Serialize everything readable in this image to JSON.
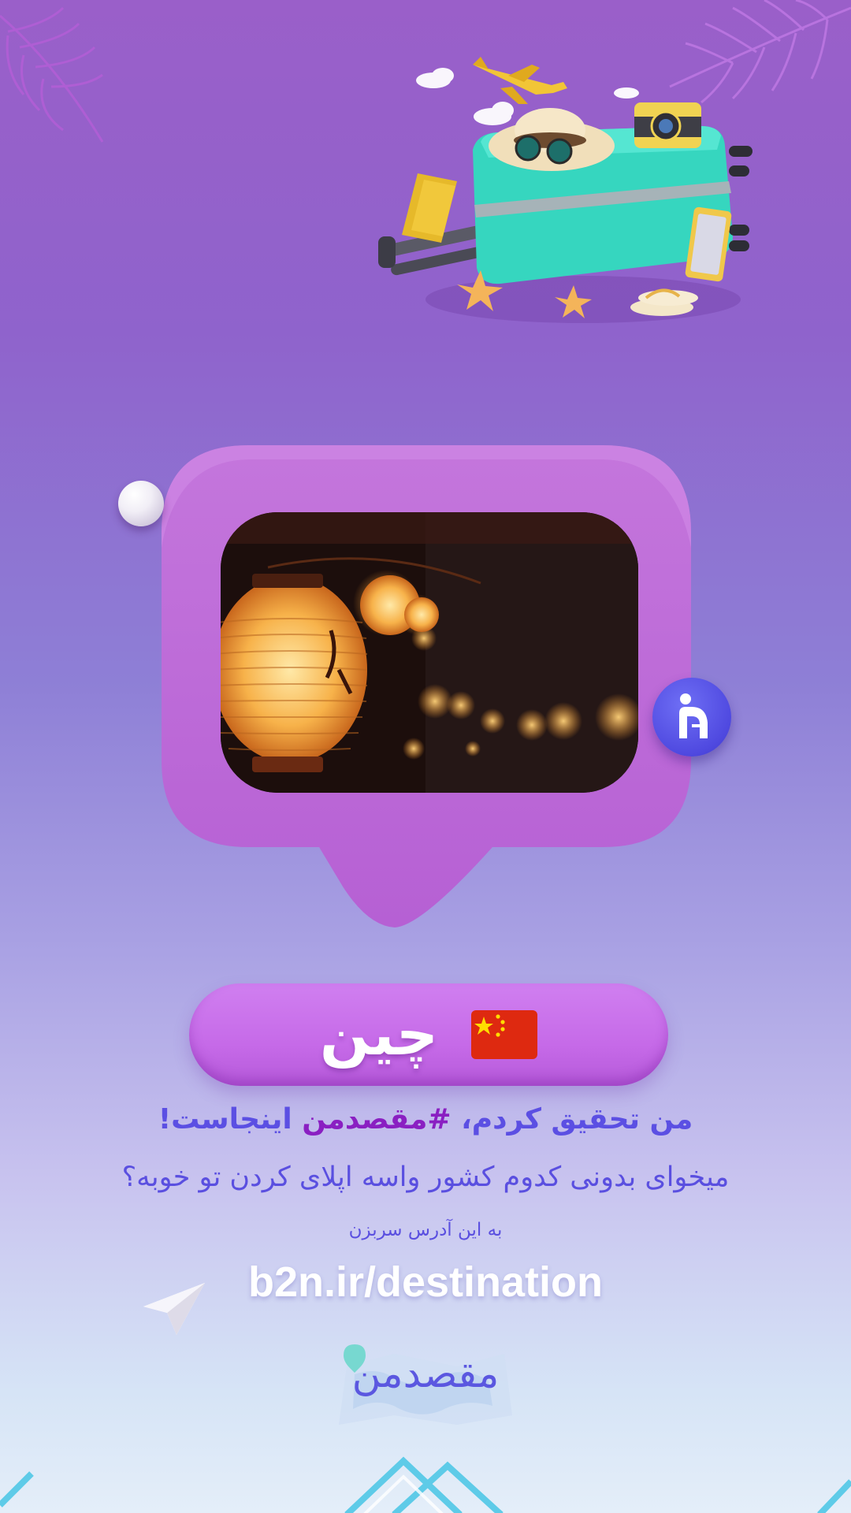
{
  "country": {
    "name": "چین",
    "flag_icon": "china-flag-icon"
  },
  "headline": {
    "part1": "من تحقیق کردم،",
    "hashtag": "#مقصدمن",
    "part2": "اینجاست!"
  },
  "question": "میخوای بدونی کدوم کشور واسه اپلای کردن تو خوبه؟",
  "hint": "به این آدرس سربزن",
  "url": "b2n.ir/destination",
  "logo": {
    "text": "مقصدمن"
  },
  "colors": {
    "accent": "#5b4fe3",
    "hashtag": "#8a1fc2",
    "bubble": "#c06ad8",
    "pill": "#c66ae8",
    "badge": "#4f49e0"
  }
}
